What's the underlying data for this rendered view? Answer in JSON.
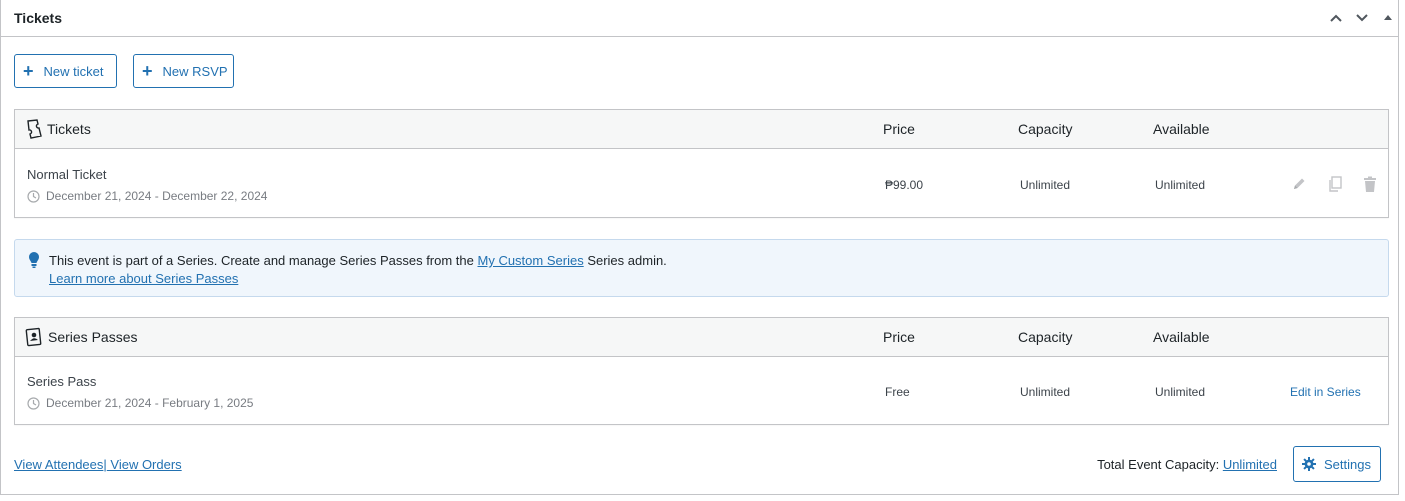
{
  "panel": {
    "title": "Tickets"
  },
  "actions": {
    "new_ticket": "New ticket",
    "new_rsvp": "New RSVP"
  },
  "tickets_table": {
    "headers": {
      "name": "Tickets",
      "price": "Price",
      "capacity": "Capacity",
      "available": "Available"
    },
    "rows": [
      {
        "name": "Normal Ticket",
        "dates": "December 21, 2024 - December 22, 2024",
        "price": "₱99.00",
        "capacity": "Unlimited",
        "available": "Unlimited"
      }
    ]
  },
  "notice": {
    "text_before": "This event is part of a Series. Create and manage Series Passes from the ",
    "series_link": "My Custom Series",
    "text_after": " Series admin.",
    "learn_more": "Learn more about Series Passes"
  },
  "series_table": {
    "headers": {
      "name": "Series Passes",
      "price": "Price",
      "capacity": "Capacity",
      "available": "Available"
    },
    "rows": [
      {
        "name": "Series Pass",
        "dates": "December 21, 2024 - February 1, 2025",
        "price": "Free",
        "capacity": "Unlimited",
        "available": "Unlimited",
        "action": "Edit in Series"
      }
    ]
  },
  "footer": {
    "view_attendees": "View Attendees",
    "separator": "|",
    "view_orders": " View Orders",
    "capacity_label": "Total Event Capacity: ",
    "capacity_value": "Unlimited",
    "settings": "Settings"
  },
  "colors": {
    "accent": "#2271b1",
    "notice_bg": "#f0f6fc",
    "border": "#c3c4c7"
  }
}
